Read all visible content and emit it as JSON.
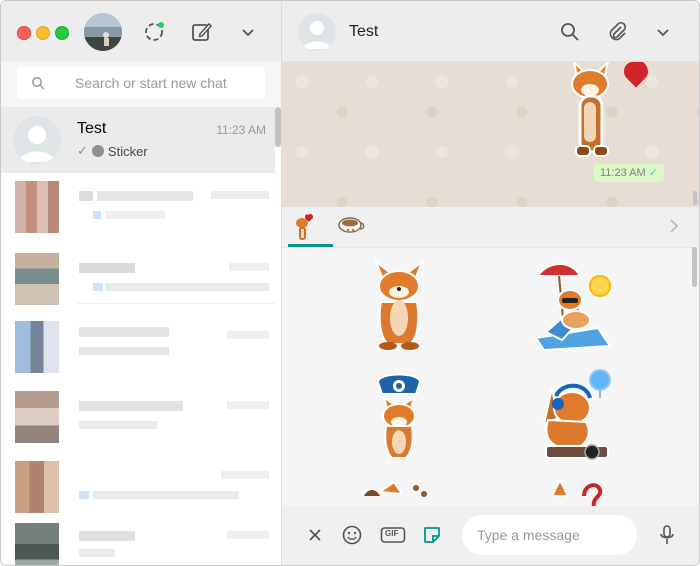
{
  "left": {
    "search_placeholder": "Search or start new chat",
    "active_chat": {
      "name": "Test",
      "time": "11:23 AM",
      "preview": "Sticker"
    }
  },
  "right": {
    "contact_name": "Test",
    "sent_time": "11:23 AM",
    "composer_placeholder": "Type a message",
    "gif_label": "GIF"
  },
  "colors": {
    "accent": "#009688",
    "bubble_out": "#dcf8c6"
  },
  "icons": [
    "status-icon",
    "new-chat-icon",
    "menu-chevron-icon",
    "search-icon",
    "attach-icon",
    "close-icon",
    "emoji-icon",
    "gif-icon",
    "sticker-icon",
    "microphone-icon"
  ]
}
